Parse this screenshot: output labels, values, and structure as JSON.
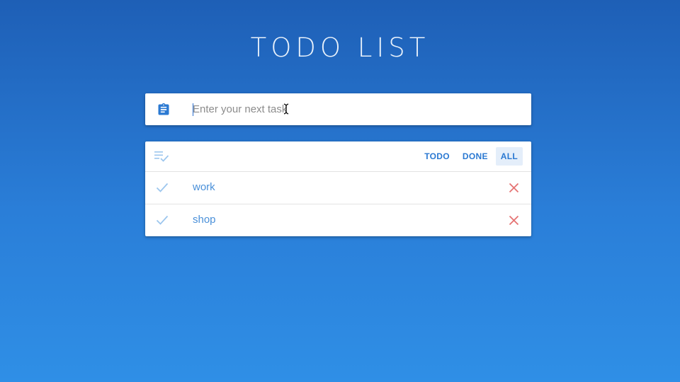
{
  "header": {
    "title": "TODO LIST"
  },
  "input": {
    "placeholder": "Enter your next task",
    "value": "",
    "icon": "clipboard-icon"
  },
  "filters": {
    "icon": "playlist-check-icon",
    "items": [
      {
        "label": "TODO",
        "active": false
      },
      {
        "label": "DONE",
        "active": false
      },
      {
        "label": "ALL",
        "active": true
      }
    ]
  },
  "tasks": [
    {
      "label": "work",
      "done": false
    },
    {
      "label": "shop",
      "done": false
    }
  ],
  "colors": {
    "accent": "#2b79d2",
    "task_text": "#4a90d9",
    "check": "#9cc6ee",
    "delete": "#e57373",
    "filter_active_bg": "#e4eefa"
  }
}
